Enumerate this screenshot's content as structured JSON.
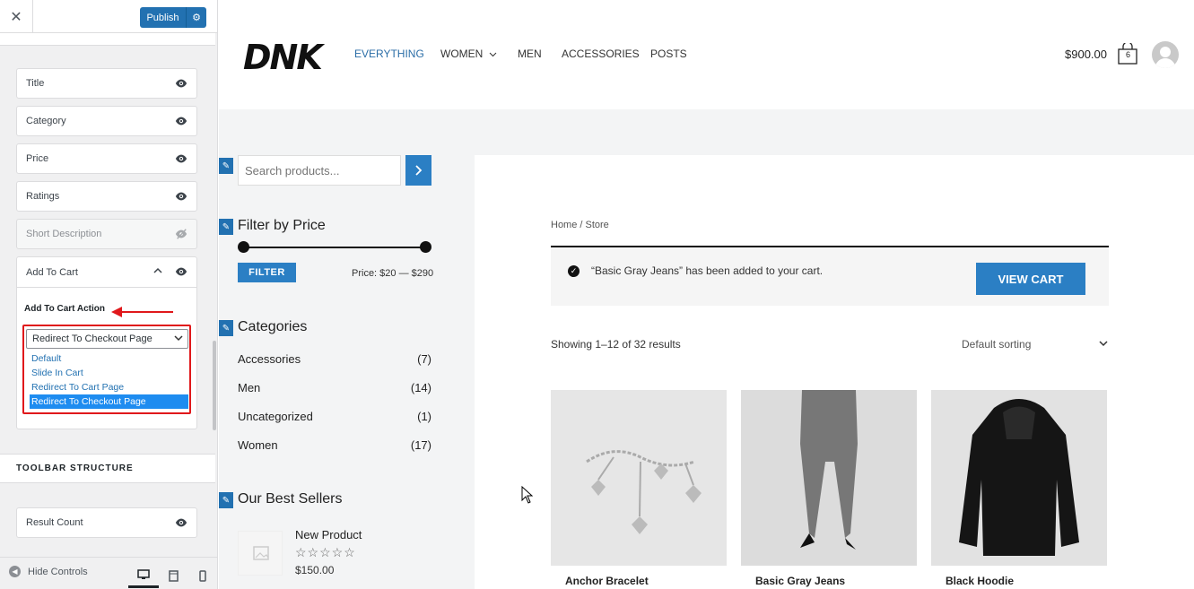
{
  "customizer": {
    "close_glyph": "✕",
    "publish_label": "Publish",
    "gear_glyph": "⚙",
    "items": [
      {
        "label": "Title",
        "visible": true
      },
      {
        "label": "Category",
        "visible": true
      },
      {
        "label": "Price",
        "visible": true
      },
      {
        "label": "Ratings",
        "visible": true
      },
      {
        "label": "Short Description",
        "visible": false
      }
    ],
    "add_to_cart": {
      "label": "Add To Cart",
      "action_label": "Add To Cart Action",
      "selected": "Redirect To Checkout Page",
      "options": [
        "Default",
        "Slide In Cart",
        "Redirect To Cart Page",
        "Redirect To Checkout Page"
      ]
    },
    "toolbar_heading": "TOOLBAR STRUCTURE",
    "toolbar_items": [
      {
        "label": "Result Count",
        "visible": true
      }
    ],
    "footer": {
      "hide_controls": "Hide Controls",
      "devices": [
        "desktop-icon",
        "tablet-icon",
        "mobile-icon"
      ],
      "active_device": "desktop"
    },
    "accent_color": "#2271b1",
    "highlight_color": "#e0181b"
  },
  "site": {
    "logo": "DNK",
    "nav": [
      "EVERYTHING",
      "WOMEN",
      "MEN",
      "ACCESSORIES",
      "POSTS"
    ],
    "nav_active": "EVERYTHING",
    "cart_total": "$900.00",
    "cart_count": "6",
    "search_placeholder": "Search products...",
    "filter": {
      "title": "Filter by Price",
      "button": "FILTER",
      "price_range": "Price: $20 — $290"
    },
    "categories": {
      "title": "Categories",
      "items": [
        {
          "name": "Accessories",
          "count": "(7)"
        },
        {
          "name": "Men",
          "count": "(14)"
        },
        {
          "name": "Uncategorized",
          "count": "(1)"
        },
        {
          "name": "Women",
          "count": "(17)"
        }
      ]
    },
    "best_sellers": {
      "title": "Our Best Sellers",
      "product": "New Product",
      "stars": "☆☆☆☆☆",
      "price": "$150.00"
    },
    "breadcrumb": "Home / Store",
    "notice": "“Basic Gray Jeans” has been added to your cart.",
    "view_cart": "VIEW CART",
    "result_count": "Showing 1–12 of 32 results",
    "sorting": "Default sorting",
    "products": [
      "Anchor Bracelet",
      "Basic Gray Jeans",
      "Black Hoodie"
    ],
    "brand_color": "#2b7fc4"
  }
}
